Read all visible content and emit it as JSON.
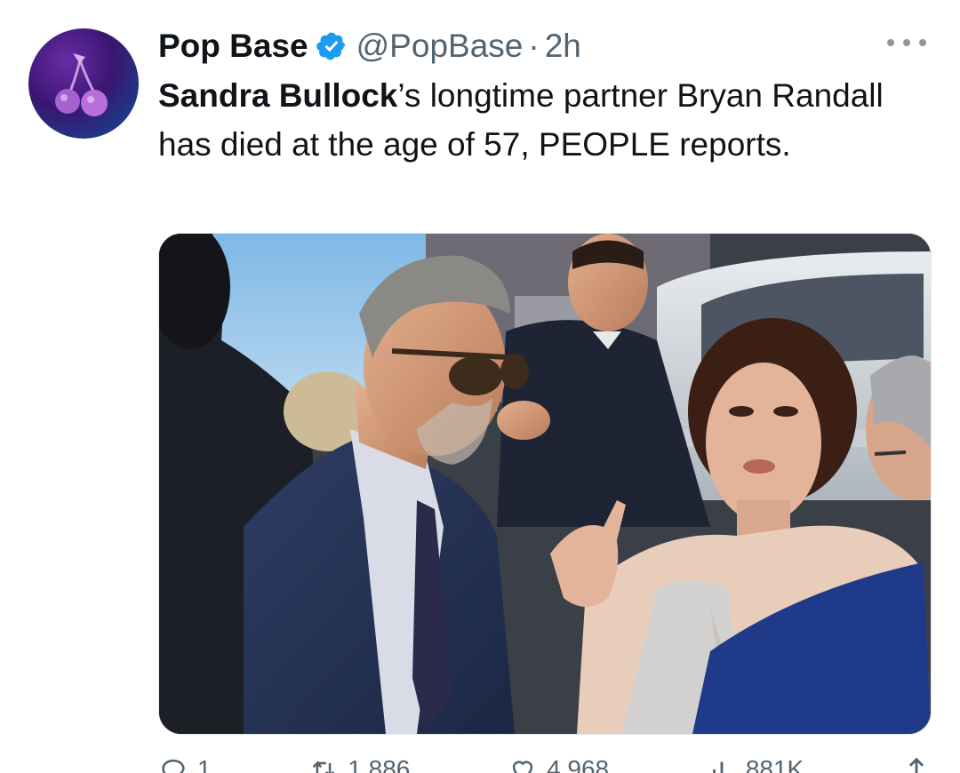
{
  "author": {
    "display_name": "Pop Base",
    "handle": "@PopBase",
    "separator": "·",
    "time": "2h",
    "verified": true
  },
  "tweet": {
    "bold_prefix": "Sandra Bullock",
    "text_rest": "’s longtime partner Bryan Randall has died at the age of 57, PEOPLE reports."
  },
  "actions": {
    "reply_count": "1",
    "retweet_count": "1,886",
    "like_count": "4,968",
    "views_count": "881K"
  },
  "colors": {
    "text": "#0f1419",
    "secondary": "#536471",
    "verified_blue": "#1d9bf0"
  },
  "icons": [
    "cherry-logo-icon",
    "verified-badge-icon",
    "more-icon",
    "reply-icon",
    "retweet-icon",
    "like-icon",
    "views-icon",
    "share-icon"
  ]
}
